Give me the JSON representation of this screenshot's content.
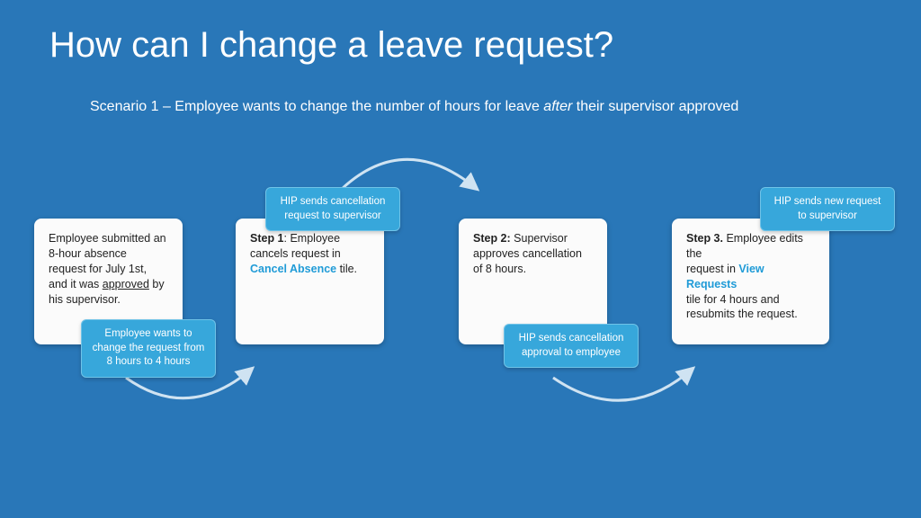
{
  "title": "How can I change a leave request?",
  "scenario_prefix": "Scenario 1 – Employee wants to change the number of hours for leave ",
  "scenario_em": "after",
  "scenario_suffix": " their supervisor approved",
  "card0_line1": "Employee submitted an",
  "card0_line2": "8-hour absence",
  "card0_line3": "request for July 1st,",
  "card0_line4a": "and it was ",
  "card0_line4u": "approved",
  "card0_line4b": " by",
  "card0_line5": "his supervisor.",
  "callout0a": "Employee wants to",
  "callout0b": "change the request from",
  "callout0c": "8 hours to 4 hours",
  "card1_b": "Step 1",
  "card1_a": ": Employee",
  "card1_line2": "cancels request in",
  "card1_link": "Cancel Absence",
  "card1_line3b": " tile.",
  "callout1a": "HIP sends cancellation",
  "callout1b": "request to supervisor",
  "card2_b": "Step 2:",
  "card2_a": " Supervisor",
  "card2_line2": "approves cancellation",
  "card2_line3": "of 8 hours.",
  "callout2a": "HIP sends cancellation",
  "callout2b": "approval to employee",
  "card3_b": "Step 3.",
  "card3_a": " Employee edits the",
  "card3_line2a": "request in ",
  "card3_link": "View Requests",
  "card3_line3": "tile for 4 hours and",
  "card3_line4": "resubmits the request.",
  "callout3a": "HIP sends new request",
  "callout3b": "to supervisor"
}
